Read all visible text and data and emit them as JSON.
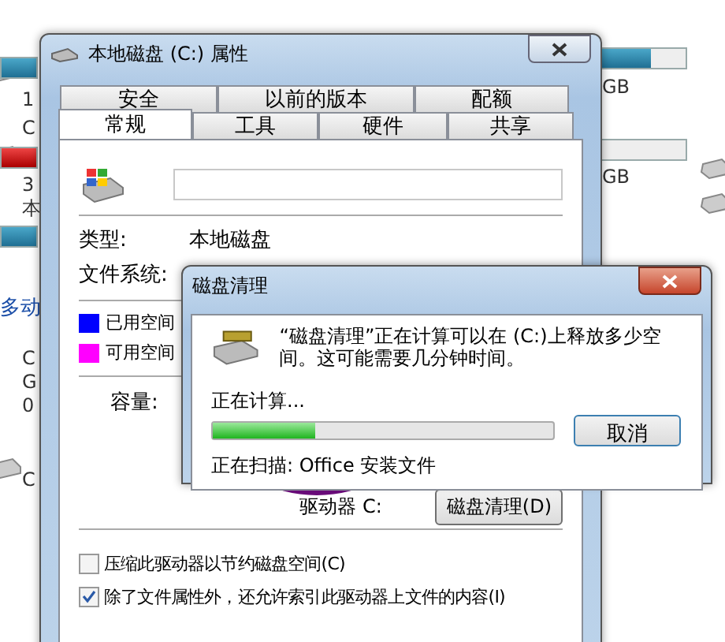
{
  "background_window": {
    "left_labels": [
      "1",
      "C",
      "3",
      "本",
      "C",
      "G",
      "0",
      "C"
    ],
    "left_heading": "多动",
    "right_labels": [
      "GB",
      "GB"
    ]
  },
  "properties": {
    "title": "本地磁盘 (C:) 属性",
    "tabs_back": [
      {
        "label": "安全",
        "selected": false
      },
      {
        "label": "以前的版本",
        "selected": false
      },
      {
        "label": "配额",
        "selected": false
      }
    ],
    "tabs_front": [
      {
        "label": "常规",
        "selected": true
      },
      {
        "label": "工具",
        "selected": false
      },
      {
        "label": "硬件",
        "selected": false
      },
      {
        "label": "共享",
        "selected": false
      }
    ],
    "info": [
      {
        "label": "类型:",
        "value": "本地磁盘"
      },
      {
        "label": "文件系统:"
      }
    ],
    "legend": [
      {
        "label": "已用空间",
        "color": "#0000ff"
      },
      {
        "label": "可用空间",
        "color": "#ff00ff"
      }
    ],
    "capacity_label": "容量:",
    "drive_label": "驱动器 C:",
    "cleanup_button": "磁盘清理(D)",
    "options": [
      {
        "label": "压缩此驱动器以节约磁盘空间(C)",
        "checked": false
      },
      {
        "label": "除了文件属性外，还允许索引此驱动器上文件的内容(I)",
        "checked": true
      }
    ]
  },
  "cleanup": {
    "title": "磁盘清理",
    "message": "“磁盘清理”正在计算可以在 (C:)上释放多少空间。这可能需要几分钟时间。",
    "status": "正在计算...",
    "progress": {
      "level": 0.3
    },
    "cancel": "取消",
    "scanning": "正在扫描: Office 安装文件"
  }
}
